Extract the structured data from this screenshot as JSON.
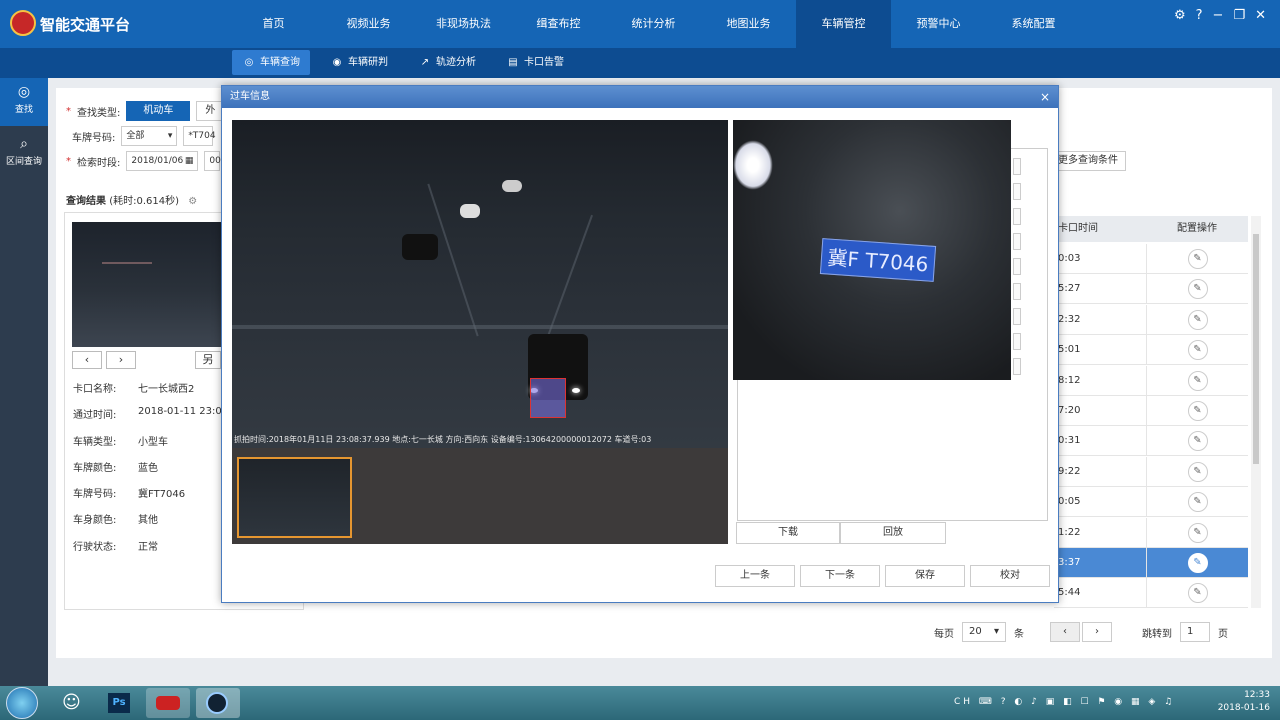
{
  "app": {
    "title": "智能交通平台"
  },
  "nav": [
    "首页",
    "视频业务",
    "非现场执法",
    "缉查布控",
    "统计分析",
    "地图业务",
    "车辆管控",
    "预警中心",
    "系统配置"
  ],
  "window_icons": {
    "settings": "⚙",
    "help": "?",
    "minimize": "−",
    "restore": "❐",
    "close": "✕"
  },
  "subnav": [
    {
      "icon": "◎",
      "label": "车辆查询"
    },
    {
      "icon": "◉",
      "label": "车辆研判"
    },
    {
      "icon": "↗",
      "label": "轨迹分析"
    },
    {
      "icon": "▤",
      "label": "卡口告警"
    }
  ],
  "sidebar": [
    {
      "icon": "◎",
      "label": "查找"
    },
    {
      "icon": "⌕",
      "label": "区间查询"
    }
  ],
  "form": {
    "type_label": "查找类型:",
    "type_motor": "机动车",
    "type_other": "外",
    "plate_label": "车牌号码:",
    "plate_select": "全部",
    "plate_value": "*T704",
    "time_label": "检索时段:",
    "date_from": "2018/01/06",
    "time_from": "00",
    "more_button": "更多查询条件"
  },
  "results": {
    "title": "查询结果",
    "elapsed": "(耗时:0.614秒)",
    "save_as": "另",
    "fields": [
      {
        "k": "卡口名称:",
        "v": "七一长城西2"
      },
      {
        "k": "通过时间:",
        "v": "2018-01-11 23:0"
      },
      {
        "k": "车辆类型:",
        "v": "小型车"
      },
      {
        "k": "车牌颜色:",
        "v": "蓝色"
      },
      {
        "k": "车牌号码:",
        "v": "冀FT7046"
      },
      {
        "k": "车身颜色:",
        "v": "其他"
      },
      {
        "k": "行驶状态:",
        "v": "正常"
      }
    ]
  },
  "table": {
    "col_time": "卡口时间",
    "col_op": "配置操作",
    "rows": [
      "0:03",
      "5:27",
      "2:32",
      "5:01",
      "8:12",
      "7:20",
      "0:31",
      "9:22",
      "0:05",
      "1:22",
      "3:37",
      "5:44"
    ],
    "selected_index": 10
  },
  "pager": {
    "per_page_label": "每页",
    "per_page": "20",
    "unit": "条",
    "jump_label": "跳转到",
    "page": "1",
    "page_unit": "页"
  },
  "modal": {
    "title": "过车信息",
    "close": "×",
    "caption": "抓拍时间:2018年01月11日 23:08:37.939  地点:七一长城  方向:西向东  设备编号:13064200000012072  车道号:03",
    "plate_text": "冀F T7046",
    "download": "下载",
    "playback": "回放",
    "prev": "上一条",
    "next": "下一条",
    "save": "保存",
    "verify": "校对"
  },
  "taskbar": {
    "time": "12:33",
    "date": "2018-01-16",
    "tray_icons": "CH ⌨ ? ◐ ♪ ▣ ◧ ☐ ⚑ ◉ ▦ ◈ ♫"
  }
}
